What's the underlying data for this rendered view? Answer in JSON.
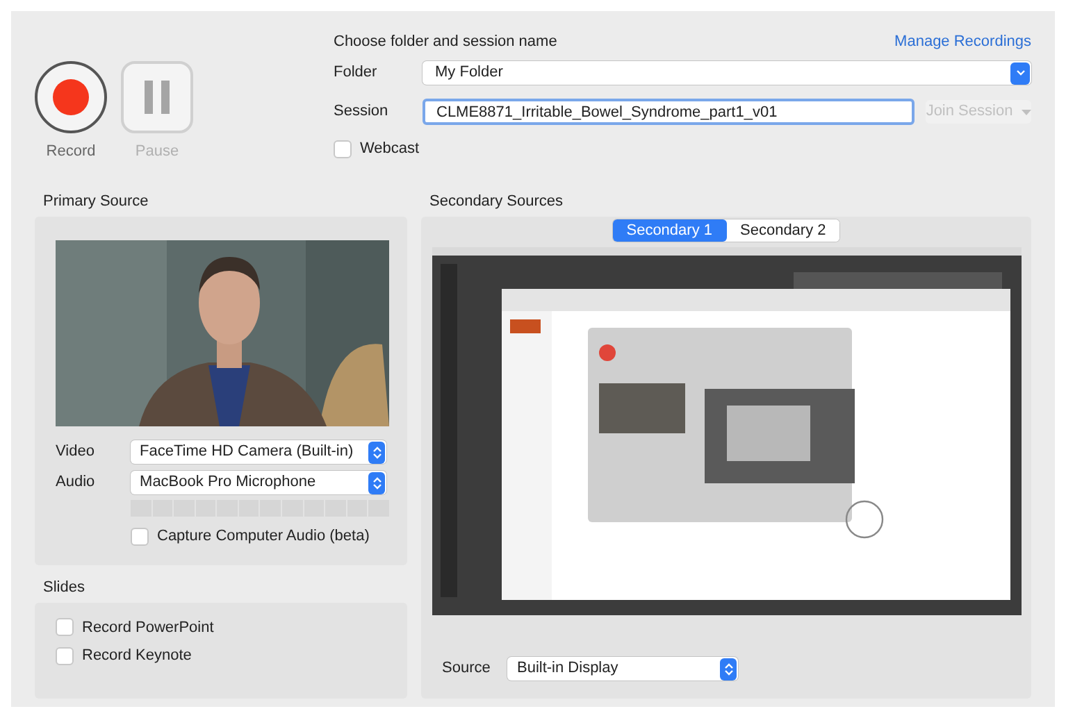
{
  "controls": {
    "record": {
      "label": "Record",
      "disabled": false
    },
    "pause": {
      "label": "Pause",
      "disabled": true
    }
  },
  "session": {
    "heading": "Choose folder and session name",
    "manage_link": "Manage Recordings",
    "folder": {
      "label": "Folder",
      "value": "My Folder"
    },
    "session": {
      "label": "Session",
      "value": "CLME8871_Irritable_Bowel_Syndrome_part1_v01",
      "focused": true
    },
    "join": {
      "label": "Join Session",
      "disabled": true
    },
    "webcast": {
      "label": "Webcast",
      "checked": false
    }
  },
  "primary": {
    "title": "Primary Source",
    "video": {
      "label": "Video",
      "value": "FaceTime HD Camera (Built-in)"
    },
    "audio": {
      "label": "Audio",
      "value": "MacBook Pro Microphone",
      "level": 0
    },
    "capture_audio": {
      "label": "Capture Computer Audio (beta)",
      "checked": false
    }
  },
  "slides": {
    "title": "Slides",
    "options": [
      {
        "label": "Record PowerPoint",
        "checked": false
      },
      {
        "label": "Record Keynote",
        "checked": false
      }
    ]
  },
  "secondary": {
    "title": "Secondary Sources",
    "tabs": [
      {
        "label": "Secondary 1",
        "selected": true
      },
      {
        "label": "Secondary 2",
        "selected": false
      }
    ],
    "source": {
      "label": "Source",
      "value": "Built-in Display"
    }
  }
}
